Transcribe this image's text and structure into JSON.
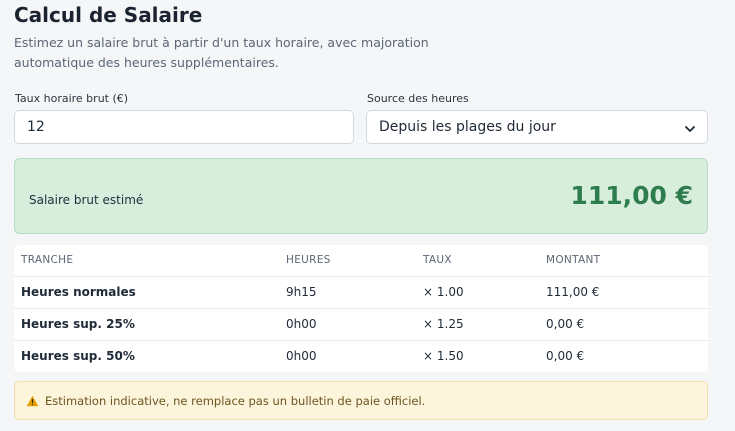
{
  "header": {
    "title": "Calcul de Salaire",
    "subtitle": "Estimez un salaire brut à partir d'un taux horaire, avec majoration automatique des heures supplémentaires."
  },
  "form": {
    "rate_label": "Taux horaire brut (€)",
    "rate_value": "12",
    "source_label": "Source des heures",
    "source_value": "Depuis les plages du jour"
  },
  "result": {
    "label": "Salaire brut estimé",
    "amount": "111,00 €"
  },
  "table": {
    "headers": [
      "TRANCHE",
      "HEURES",
      "TAUX",
      "MONTANT"
    ],
    "rows": [
      {
        "tranche": "Heures normales",
        "heures": "9h15",
        "taux": "× 1.00",
        "montant": "111,00 €"
      },
      {
        "tranche": "Heures sup. 25%",
        "heures": "0h00",
        "taux": "× 1.25",
        "montant": "0,00 €"
      },
      {
        "tranche": "Heures sup. 50%",
        "heures": "0h00",
        "taux": "× 1.50",
        "montant": "0,00 €"
      }
    ]
  },
  "notice": {
    "icon": "warning-icon",
    "text": "Estimation indicative, ne remplace pas un bulletin de paie officiel."
  },
  "colors": {
    "accent_green": "#2e7d4f",
    "result_bg": "#d8eedd",
    "notice_bg": "#fdf4dc",
    "warning": "#e0a000"
  }
}
